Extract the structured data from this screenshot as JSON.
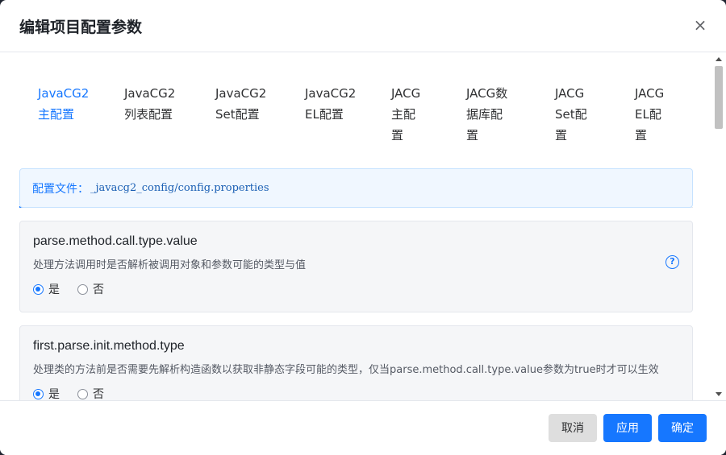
{
  "dialog": {
    "title": "编辑项目配置参数",
    "close_symbol": "×"
  },
  "tabs": [
    {
      "lines": [
        "JavaCG2",
        "主配置"
      ],
      "active": true
    },
    {
      "lines": [
        "JavaCG2",
        "列表配置"
      ],
      "active": false
    },
    {
      "lines": [
        "JavaCG2",
        "Set配置"
      ],
      "active": false
    },
    {
      "lines": [
        "JavaCG2",
        "EL配置"
      ],
      "active": false
    },
    {
      "lines": [
        "JACG",
        "主配",
        "置"
      ],
      "active": false
    },
    {
      "lines": [
        "JACG数",
        "据库配",
        "置"
      ],
      "active": false
    },
    {
      "lines": [
        "JACG",
        "Set配",
        "置"
      ],
      "active": false
    },
    {
      "lines": [
        "JACG",
        "EL配",
        "置"
      ],
      "active": false
    }
  ],
  "info": {
    "label": "配置文件：",
    "path": "_javacg2_config/config.properties"
  },
  "params": [
    {
      "name": "parse.method.call.type.value",
      "desc": "处理方法调用时是否解析被调用对象和参数可能的类型与值",
      "options": [
        "是",
        "否"
      ],
      "selected": "是",
      "help": "?"
    },
    {
      "name": "first.parse.init.method.type",
      "desc": "处理类的方法前是否需要先解析构造函数以获取非静态字段可能的类型，仅当parse.method.call.type.value参数为true时才可以生效",
      "options": [
        "是",
        "否"
      ],
      "selected": "是"
    }
  ],
  "footer": {
    "cancel_label": "取消",
    "apply_label": "应用",
    "ok_label": "确定"
  },
  "colors": {
    "accent": "#1677ff",
    "card_bg": "#f5f6f8",
    "info_bg": "#f0f7ff"
  }
}
